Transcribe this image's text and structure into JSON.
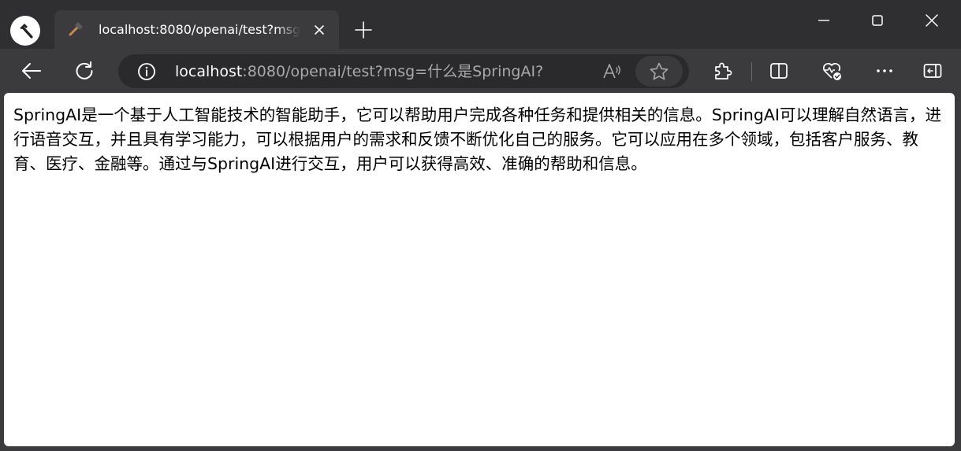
{
  "browser": {
    "tab": {
      "title": "localhost:8080/openai/test?msg=什么是SpringAI?"
    },
    "address": {
      "host": "localhost",
      "rest": ":8080/openai/test?msg=什么是SpringAI?"
    },
    "icons": {
      "app": "hammer-icon",
      "favicon": "hammer-icon",
      "close_tab": "close-icon",
      "new_tab": "plus-icon",
      "minimize": "minimize-icon",
      "maximize": "maximize-icon",
      "close_window": "close-icon",
      "back": "arrow-left-icon",
      "refresh": "refresh-icon",
      "site_info": "info-icon",
      "read_aloud": "read-aloud-icon",
      "favorite": "star-icon",
      "extensions": "puzzle-icon",
      "split_screen": "split-screen-icon",
      "browser_essentials": "heart-pulse-icon",
      "more": "more-icon",
      "sidebar": "sidebar-icon"
    },
    "colors": {
      "titlebar": "#2f2f31",
      "toolbar": "#3b3b3d",
      "address_bg": "#2a2a2c",
      "page_bg": "#ffffff"
    }
  },
  "page": {
    "text": "SpringAI是一个基于人工智能技术的智能助手，它可以帮助用户完成各种任务和提供相关的信息。SpringAI可以理解自然语言，进行语音交互，并且具有学习能力，可以根据用户的需求和反馈不断优化自己的服务。它可以应用在多个领域，包括客户服务、教育、医疗、金融等。通过与SpringAI进行交互，用户可以获得高效、准确的帮助和信息。"
  }
}
